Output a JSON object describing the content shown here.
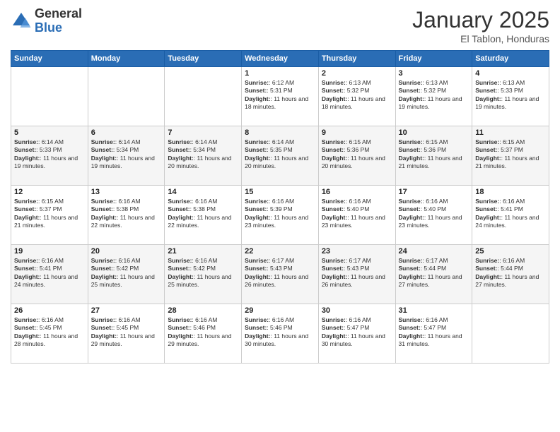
{
  "header": {
    "logo_general": "General",
    "logo_blue": "Blue",
    "month_title": "January 2025",
    "location": "El Tablon, Honduras"
  },
  "days_of_week": [
    "Sunday",
    "Monday",
    "Tuesday",
    "Wednesday",
    "Thursday",
    "Friday",
    "Saturday"
  ],
  "weeks": [
    [
      {
        "day": "",
        "text": ""
      },
      {
        "day": "",
        "text": ""
      },
      {
        "day": "",
        "text": ""
      },
      {
        "day": "1",
        "text": "Sunrise: 6:12 AM\nSunset: 5:31 PM\nDaylight: 11 hours and 18 minutes."
      },
      {
        "day": "2",
        "text": "Sunrise: 6:13 AM\nSunset: 5:32 PM\nDaylight: 11 hours and 18 minutes."
      },
      {
        "day": "3",
        "text": "Sunrise: 6:13 AM\nSunset: 5:32 PM\nDaylight: 11 hours and 19 minutes."
      },
      {
        "day": "4",
        "text": "Sunrise: 6:13 AM\nSunset: 5:33 PM\nDaylight: 11 hours and 19 minutes."
      }
    ],
    [
      {
        "day": "5",
        "text": "Sunrise: 6:14 AM\nSunset: 5:33 PM\nDaylight: 11 hours and 19 minutes."
      },
      {
        "day": "6",
        "text": "Sunrise: 6:14 AM\nSunset: 5:34 PM\nDaylight: 11 hours and 19 minutes."
      },
      {
        "day": "7",
        "text": "Sunrise: 6:14 AM\nSunset: 5:34 PM\nDaylight: 11 hours and 20 minutes."
      },
      {
        "day": "8",
        "text": "Sunrise: 6:14 AM\nSunset: 5:35 PM\nDaylight: 11 hours and 20 minutes."
      },
      {
        "day": "9",
        "text": "Sunrise: 6:15 AM\nSunset: 5:36 PM\nDaylight: 11 hours and 20 minutes."
      },
      {
        "day": "10",
        "text": "Sunrise: 6:15 AM\nSunset: 5:36 PM\nDaylight: 11 hours and 21 minutes."
      },
      {
        "day": "11",
        "text": "Sunrise: 6:15 AM\nSunset: 5:37 PM\nDaylight: 11 hours and 21 minutes."
      }
    ],
    [
      {
        "day": "12",
        "text": "Sunrise: 6:15 AM\nSunset: 5:37 PM\nDaylight: 11 hours and 21 minutes."
      },
      {
        "day": "13",
        "text": "Sunrise: 6:16 AM\nSunset: 5:38 PM\nDaylight: 11 hours and 22 minutes."
      },
      {
        "day": "14",
        "text": "Sunrise: 6:16 AM\nSunset: 5:38 PM\nDaylight: 11 hours and 22 minutes."
      },
      {
        "day": "15",
        "text": "Sunrise: 6:16 AM\nSunset: 5:39 PM\nDaylight: 11 hours and 23 minutes."
      },
      {
        "day": "16",
        "text": "Sunrise: 6:16 AM\nSunset: 5:40 PM\nDaylight: 11 hours and 23 minutes."
      },
      {
        "day": "17",
        "text": "Sunrise: 6:16 AM\nSunset: 5:40 PM\nDaylight: 11 hours and 23 minutes."
      },
      {
        "day": "18",
        "text": "Sunrise: 6:16 AM\nSunset: 5:41 PM\nDaylight: 11 hours and 24 minutes."
      }
    ],
    [
      {
        "day": "19",
        "text": "Sunrise: 6:16 AM\nSunset: 5:41 PM\nDaylight: 11 hours and 24 minutes."
      },
      {
        "day": "20",
        "text": "Sunrise: 6:16 AM\nSunset: 5:42 PM\nDaylight: 11 hours and 25 minutes."
      },
      {
        "day": "21",
        "text": "Sunrise: 6:16 AM\nSunset: 5:42 PM\nDaylight: 11 hours and 25 minutes."
      },
      {
        "day": "22",
        "text": "Sunrise: 6:17 AM\nSunset: 5:43 PM\nDaylight: 11 hours and 26 minutes."
      },
      {
        "day": "23",
        "text": "Sunrise: 6:17 AM\nSunset: 5:43 PM\nDaylight: 11 hours and 26 minutes."
      },
      {
        "day": "24",
        "text": "Sunrise: 6:17 AM\nSunset: 5:44 PM\nDaylight: 11 hours and 27 minutes."
      },
      {
        "day": "25",
        "text": "Sunrise: 6:16 AM\nSunset: 5:44 PM\nDaylight: 11 hours and 27 minutes."
      }
    ],
    [
      {
        "day": "26",
        "text": "Sunrise: 6:16 AM\nSunset: 5:45 PM\nDaylight: 11 hours and 28 minutes."
      },
      {
        "day": "27",
        "text": "Sunrise: 6:16 AM\nSunset: 5:45 PM\nDaylight: 11 hours and 29 minutes."
      },
      {
        "day": "28",
        "text": "Sunrise: 6:16 AM\nSunset: 5:46 PM\nDaylight: 11 hours and 29 minutes."
      },
      {
        "day": "29",
        "text": "Sunrise: 6:16 AM\nSunset: 5:46 PM\nDaylight: 11 hours and 30 minutes."
      },
      {
        "day": "30",
        "text": "Sunrise: 6:16 AM\nSunset: 5:47 PM\nDaylight: 11 hours and 30 minutes."
      },
      {
        "day": "31",
        "text": "Sunrise: 6:16 AM\nSunset: 5:47 PM\nDaylight: 11 hours and 31 minutes."
      },
      {
        "day": "",
        "text": ""
      }
    ]
  ]
}
